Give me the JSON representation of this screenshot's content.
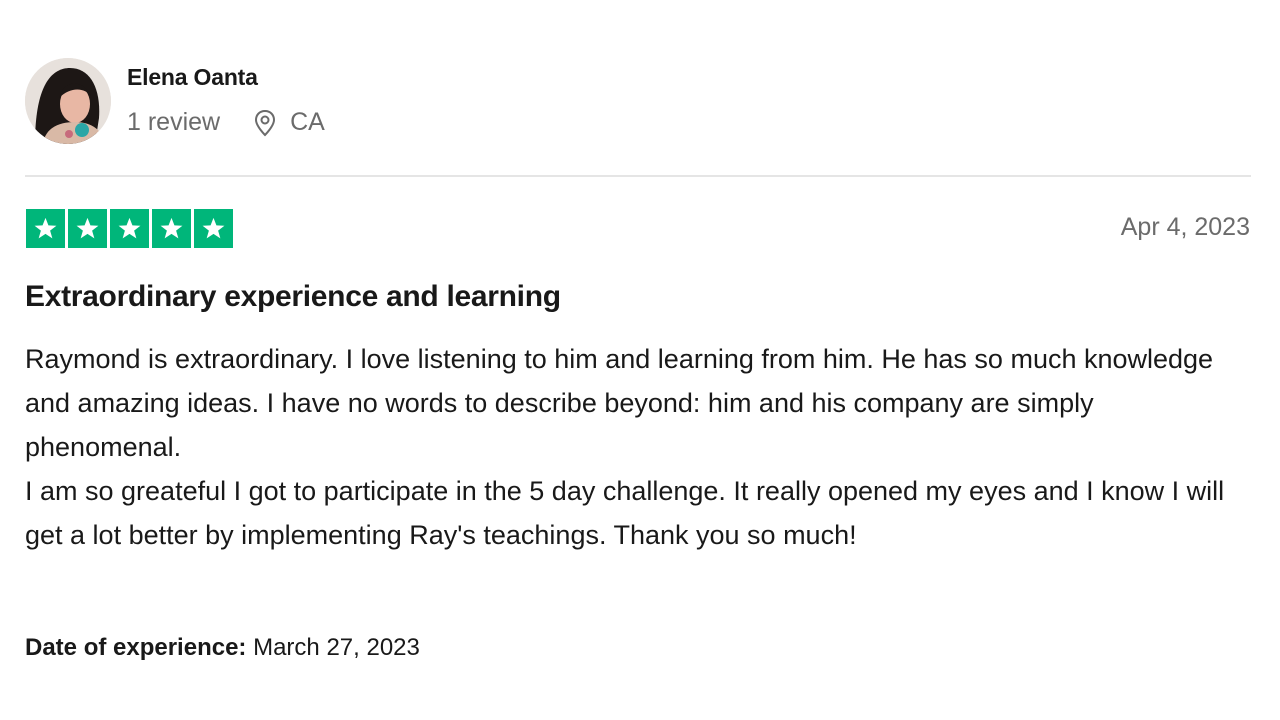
{
  "consumer": {
    "name": "Elena Oanta",
    "review_count": "1 review",
    "location": "CA",
    "location_icon": "location-pin-icon"
  },
  "review": {
    "rating": 5,
    "rating_max": 5,
    "star_color": "#00b67a",
    "date": "Apr 4, 2023",
    "title": "Extraordinary experience and learning",
    "paragraphs": [
      "Raymond is extraordinary. I love listening to him and learning from him. He has so much knowledge and amazing ideas. I have no words to describe beyond: him and his company are simply phenomenal.",
      "I am so greateful I got to participate in the 5 day challenge. It really opened my eyes and I know I will get a lot better by implementing Ray's teachings. Thank you so much!"
    ],
    "experience_label": "Date of experience:",
    "experience_date": "March 27, 2023"
  }
}
